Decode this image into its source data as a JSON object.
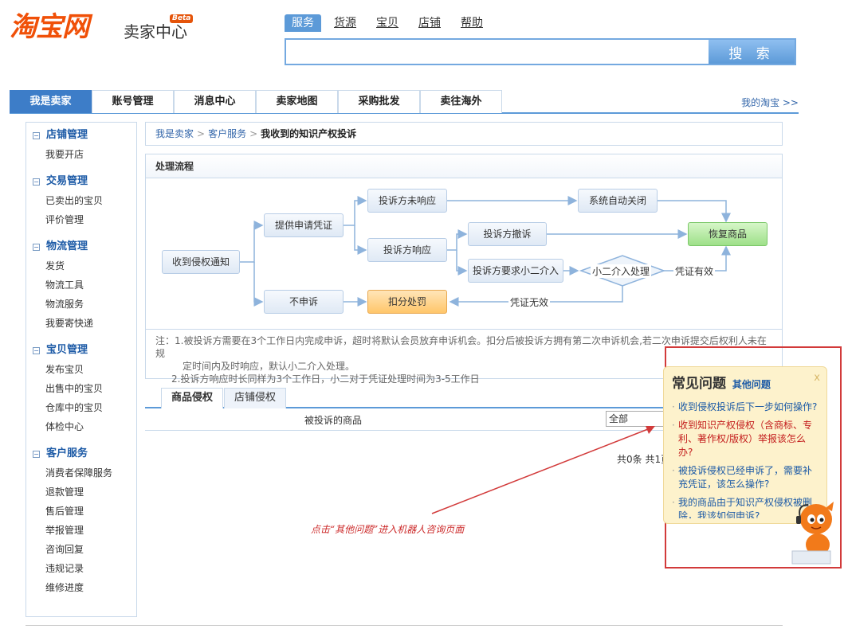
{
  "logo": {
    "main": "淘宝网",
    "sub": "卖家中心",
    "beta": "Beta"
  },
  "search": {
    "tabs": [
      "服务",
      "货源",
      "宝贝",
      "店铺",
      "帮助"
    ],
    "button": "搜 索",
    "value": ""
  },
  "nav": {
    "tabs": [
      "我是卖家",
      "账号管理",
      "消息中心",
      "卖家地图",
      "采购批发",
      "卖往海外"
    ],
    "right": "我的淘宝 >>"
  },
  "sidebar": [
    {
      "title": "店铺管理",
      "items": [
        "我要开店"
      ]
    },
    {
      "title": "交易管理",
      "items": [
        "已卖出的宝贝",
        "评价管理"
      ]
    },
    {
      "title": "物流管理",
      "items": [
        "发货",
        "物流工具",
        "物流服务",
        "我要寄快递"
      ]
    },
    {
      "title": "宝贝管理",
      "items": [
        "发布宝贝",
        "出售中的宝贝",
        "仓库中的宝贝",
        "体检中心"
      ]
    },
    {
      "title": "客户服务",
      "items": [
        "消费者保障服务",
        "退款管理",
        "售后管理",
        "举报管理",
        "咨询回复",
        "违规记录",
        "维修进度"
      ]
    }
  ],
  "breadcrumb": {
    "items": [
      "我是卖家",
      "客户服务"
    ],
    "current": "我收到的知识产权投诉",
    "sep": ">"
  },
  "flow": {
    "title": "处理流程",
    "nodes": {
      "receive": "收到侵权通知",
      "provide": "提供申请凭证",
      "no_appeal": "不申诉",
      "no_response": "投诉方未响应",
      "response": "投诉方响应",
      "withdraw": "投诉方撤诉",
      "request": "投诉方要求小二介入",
      "penalty": "扣分处罚",
      "auto_close": "系统自动关闭",
      "restore": "恢复商品",
      "decision": "小二介入处理"
    },
    "labels": {
      "valid": "凭证有效",
      "invalid": "凭证无效"
    },
    "notes": [
      "注：1.被投诉方需要在3个工作日内完成申诉，超时将默认会员放弃申诉机会。扣分后被投诉方拥有第二次申诉机会,若二次申诉提交后权利人未在规",
      "定时间内及时响应，默认小二介入处理。",
      "2.投诉方响应时长同样为3个工作日，小二对于凭证处理时间为3-5工作日"
    ]
  },
  "tabs": [
    "商品侵权",
    "店铺侵权"
  ],
  "table": {
    "header": "被投诉的商品",
    "filter": "全部"
  },
  "pager": "共0条 共1页",
  "hint": "点击“其他问题”进入机器人咨询页面",
  "faq": {
    "title": "常见问题",
    "other": "其他问题",
    "close": "x",
    "items": [
      "收到侵权投诉后下一步如何操作?",
      "收到知识产权侵权（含商标、专利、著作权/版权）举报该怎么办?",
      "被投诉侵权已经申诉了，需要补充凭证，该怎么操作?",
      "我的商品由于知识产权侵权被删除，我该如何申诉?"
    ]
  },
  "colors": {
    "accent": "#3d7dc8",
    "brand": "#f05008",
    "highlight": "#d23a3a"
  }
}
